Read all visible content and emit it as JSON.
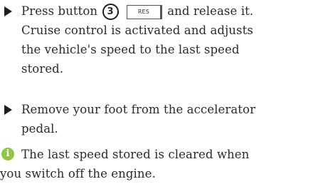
{
  "steps": [
    {
      "lines": [
        {
          "pre": "Press button",
          "circle": "3",
          "key": "RES",
          "post": "and release it."
        },
        "Cruise control is activated and adjusts",
        "the vehicle's speed to the last speed",
        "stored."
      ]
    },
    {
      "lines": [
        "Remove your foot from the accelerator",
        "pedal."
      ]
    }
  ],
  "note": {
    "icon": "info-icon",
    "icon_color": "#8ec63f",
    "icon_glyph": "i",
    "lines": [
      "The last speed stored is cleared when",
      "you switch off the engine."
    ]
  }
}
